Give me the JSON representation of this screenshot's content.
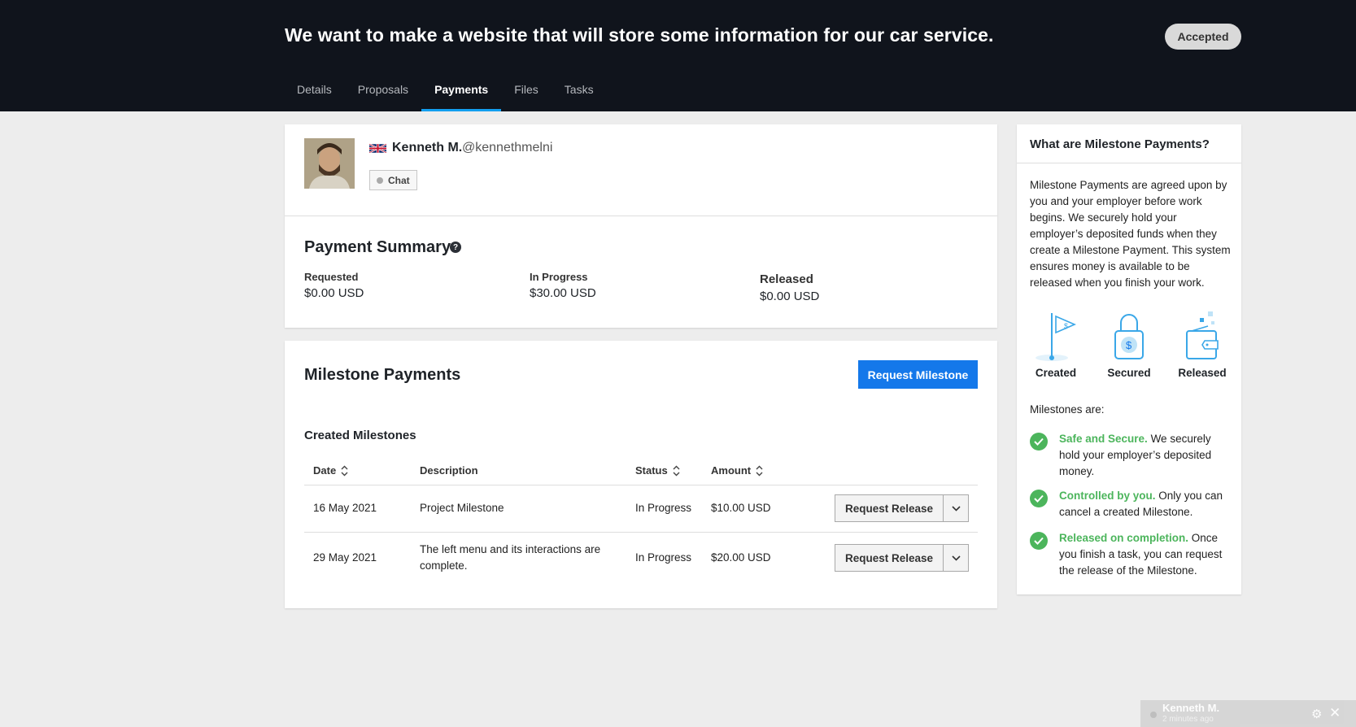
{
  "header": {
    "title": "We want to make a website that will store some information for our car service.",
    "status": "Accepted",
    "tabs": [
      {
        "label": "Details"
      },
      {
        "label": "Proposals"
      },
      {
        "label": "Payments"
      },
      {
        "label": "Files"
      },
      {
        "label": "Tasks"
      }
    ],
    "active_tab": "Payments"
  },
  "profile": {
    "name": "Kenneth M.",
    "handle": "@kennethmelni",
    "chat_label": "Chat",
    "flag_icon": "uk-flag-icon"
  },
  "payment_summary": {
    "title": "Payment Summary",
    "help_icon": "?",
    "requested_label": "Requested",
    "requested_value": "$0.00 USD",
    "in_progress_label": "In Progress",
    "in_progress_value": "$30.00 USD",
    "released_label": "Released",
    "released_value": "$0.00 USD"
  },
  "milestones": {
    "title": "Milestone Payments",
    "request_button": "Request Milestone",
    "created_title": "Created Milestones",
    "columns": {
      "date": "Date",
      "description": "Description",
      "status": "Status",
      "amount": "Amount"
    },
    "rows": [
      {
        "date": "16 May 2021",
        "description": "Project Milestone",
        "status": "In Progress",
        "amount": "$10.00 USD",
        "action": "Request Release"
      },
      {
        "date": "29 May 2021",
        "description": "The left menu and its interactions are complete.",
        "status": "In Progress",
        "amount": "$20.00 USD",
        "action": "Request Release"
      }
    ]
  },
  "sidebar": {
    "title": "What are Milestone Payments?",
    "description": "Milestone Payments are agreed upon by you and your employer before work begins. We securely hold your employer’s deposited funds when they create a Milestone Payment. This system ensures money is available to be released when you finish your work.",
    "stages": [
      {
        "label": "Created",
        "icon": "flag-icon"
      },
      {
        "label": "Secured",
        "icon": "lock-icon"
      },
      {
        "label": "Released",
        "icon": "wallet-icon"
      }
    ],
    "milestones_are": "Milestones are:",
    "features": [
      {
        "highlight": "Safe and Secure.",
        "text": " We securely hold your employer’s deposited money."
      },
      {
        "highlight": "Controlled by you.",
        "text": " Only you can cancel a created Milestone."
      },
      {
        "highlight": "Released on completion.",
        "text": " Once you finish a task, you can request the release of the Milestone."
      }
    ]
  },
  "chat_dock": {
    "name": "Kenneth M.",
    "time": "2 minutes ago"
  },
  "colors": {
    "header_bg": "#10141c",
    "primary": "#1478ea",
    "tab_underline": "#139ff0",
    "success": "#4cb55c",
    "page_bg": "#ededed"
  }
}
